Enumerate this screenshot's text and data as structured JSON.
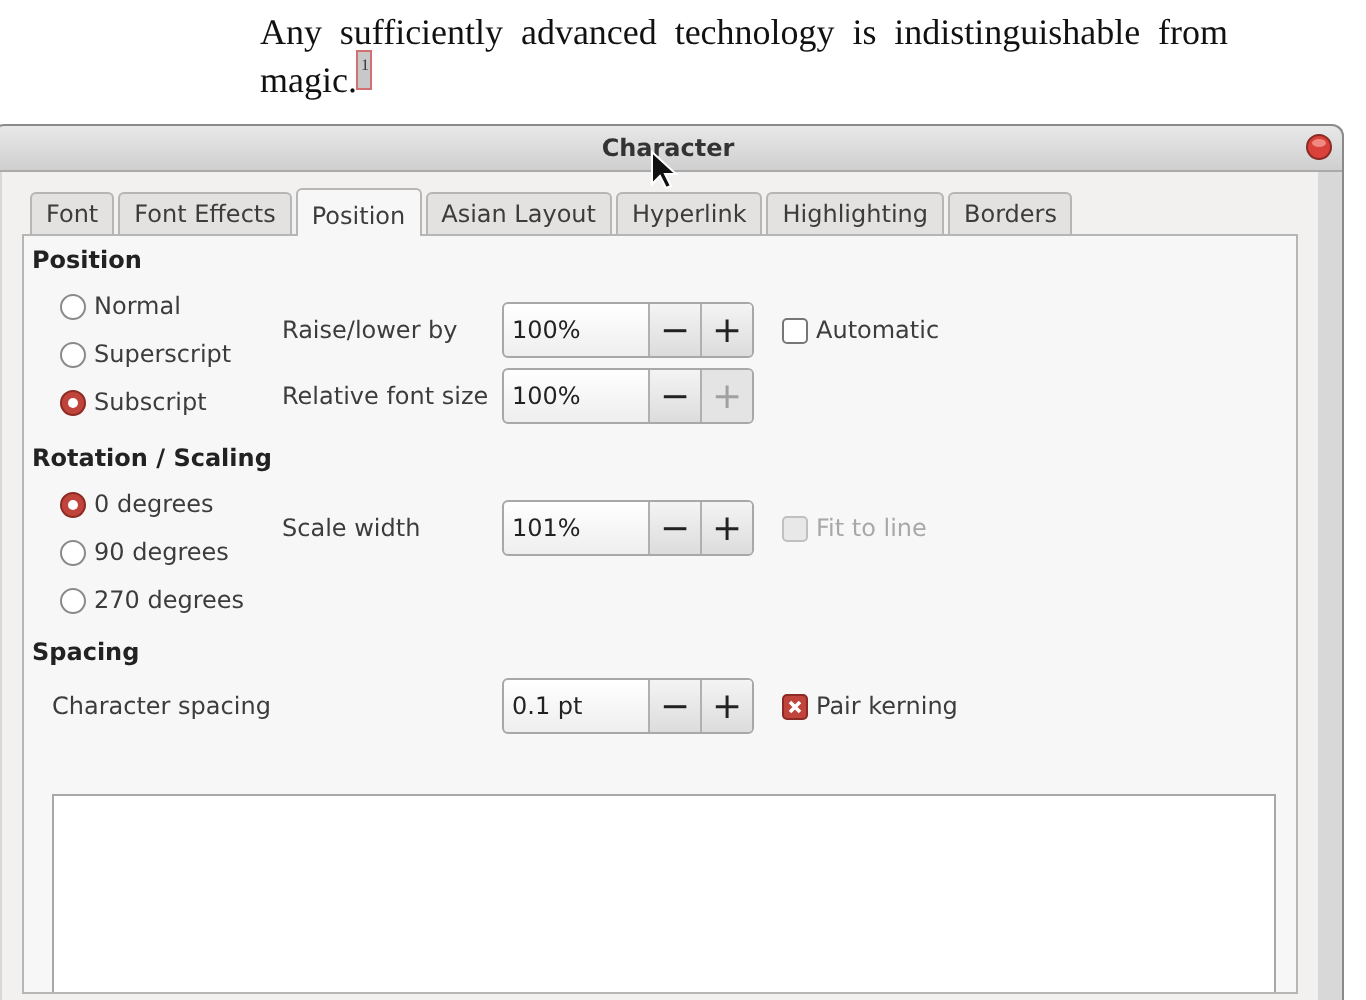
{
  "document": {
    "paragraph": "Any sufficiently advanced technology is indistinguishable from magic.$^{1}$"
  },
  "dialog": {
    "title": "Character",
    "tabs": [
      {
        "label": "Font",
        "selected": false
      },
      {
        "label": "Font Effects",
        "selected": false
      },
      {
        "label": "Position",
        "selected": true
      },
      {
        "label": "Asian Layout",
        "selected": false
      },
      {
        "label": "Hyperlink",
        "selected": false
      },
      {
        "label": "Highlighting",
        "selected": false
      },
      {
        "label": "Borders",
        "selected": false
      }
    ],
    "sections": [
      {
        "title": "Position",
        "options": [
          {
            "label": "Normal",
            "selected": false
          },
          {
            "label": "Superscript",
            "selected": false
          },
          {
            "label": "Subscript",
            "selected": true
          }
        ],
        "controls": [
          {
            "label": "Raise/lower by",
            "value": "100%",
            "decrement": {
              "glyph": "−",
              "disabled": false
            },
            "increment": {
              "glyph": "+",
              "disabled": false
            },
            "checkbox": {
              "label": "Automatic",
              "checked": false,
              "disabled": false
            }
          },
          {
            "label": "Relative font size",
            "value": "100%",
            "decrement": {
              "glyph": "−",
              "disabled": false
            },
            "increment": {
              "glyph": "+",
              "disabled": true
            }
          }
        ]
      },
      {
        "title": "Rotation / Scaling",
        "options": [
          {
            "label": "0 degrees",
            "selected": true
          },
          {
            "label": "90 degrees",
            "selected": false
          },
          {
            "label": "270 degrees",
            "selected": false
          }
        ],
        "controls": [
          {
            "label": "Scale width",
            "value": "101%",
            "decrement": {
              "glyph": "−",
              "disabled": false
            },
            "increment": {
              "glyph": "+",
              "disabled": false
            },
            "checkbox": {
              "label": "Fit to line",
              "checked": false,
              "disabled": true
            }
          }
        ]
      },
      {
        "title": "Spacing",
        "controls": [
          {
            "label": "Character spacing",
            "value": "0.1 pt",
            "decrement": {
              "glyph": "−",
              "disabled": false
            },
            "increment": {
              "glyph": "+",
              "disabled": false
            },
            "checkbox": {
              "label": "Pair kerning",
              "checked": true,
              "disabled": false
            }
          }
        ]
      }
    ]
  }
}
